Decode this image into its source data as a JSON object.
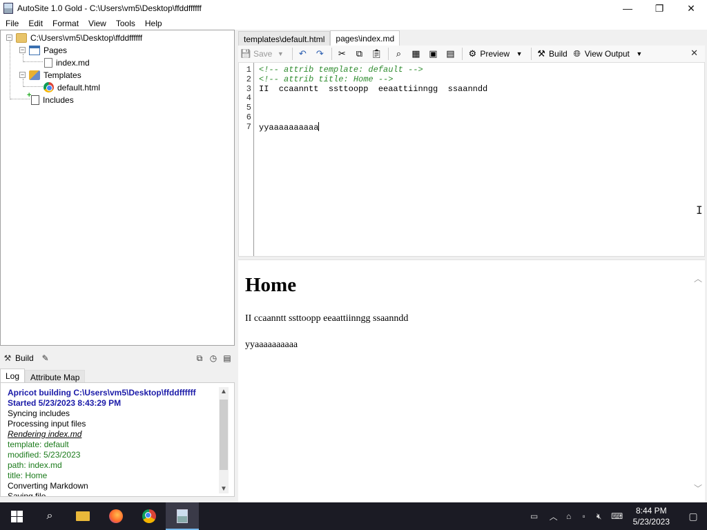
{
  "window": {
    "title": "AutoSite 1.0 Gold - C:\\Users\\vm5\\Desktop\\ffddffffff"
  },
  "window_controls": {
    "minimize": "—",
    "maximize": "❐",
    "close": "✕"
  },
  "menu": [
    "File",
    "Edit",
    "Format",
    "View",
    "Tools",
    "Help"
  ],
  "tree": {
    "root": "C:\\Users\\vm5\\Desktop\\ffddffffff",
    "pages": "Pages",
    "page_item": "index.md",
    "templates": "Templates",
    "template_item": "default.html",
    "includes": "Includes"
  },
  "build_panel": {
    "build_label": "Build",
    "tabs": [
      "Log",
      "Attribute Map"
    ],
    "log": [
      {
        "text": "Apricot building C:\\Users\\vm5\\Desktop\\ffddffffff",
        "style": "blue"
      },
      {
        "text": "Started 5/23/2023 8:43:29 PM",
        "style": "blue"
      },
      {
        "text": "Syncing includes",
        "style": "normal"
      },
      {
        "text": "Processing input files",
        "style": "normal"
      },
      {
        "text": "Rendering index.md",
        "style": "italic"
      },
      {
        "text": " template: default",
        "style": "green"
      },
      {
        "text": " modified: 5/23/2023",
        "style": "green"
      },
      {
        "text": " path: index.md",
        "style": "green"
      },
      {
        "text": " title: Home",
        "style": "green"
      },
      {
        "text": "Converting Markdown",
        "style": "normal"
      },
      {
        "text": "Saving file",
        "style": "normal"
      }
    ]
  },
  "editor_tabs": [
    "templates\\default.html",
    "pages\\index.md"
  ],
  "toolbar": {
    "save": "Save",
    "preview": "Preview",
    "build": "Build",
    "view_output": "View Output"
  },
  "editor": {
    "lines": [
      {
        "num": "1",
        "text": "<!-- attrib template: default -->",
        "kind": "comment"
      },
      {
        "num": "2",
        "text": "<!-- attrib title: Home -->",
        "kind": "comment"
      },
      {
        "num": "3",
        "text": "II  ccaanntt  ssttoopp  eeaattiinngg  ssaanndd",
        "kind": "text"
      },
      {
        "num": "4",
        "text": "",
        "kind": "text"
      },
      {
        "num": "5",
        "text": "",
        "kind": "text"
      },
      {
        "num": "6",
        "text": "",
        "kind": "text"
      },
      {
        "num": "7",
        "text": "yyaaaaaaaaaa",
        "kind": "text"
      }
    ]
  },
  "preview": {
    "heading": "Home",
    "paragraphs": [
      "II ccaanntt ssttoopp eeaattiinngg ssaanndd",
      "yyaaaaaaaaaa"
    ]
  },
  "taskbar": {
    "time": "8:44 PM",
    "date": "5/23/2023"
  }
}
